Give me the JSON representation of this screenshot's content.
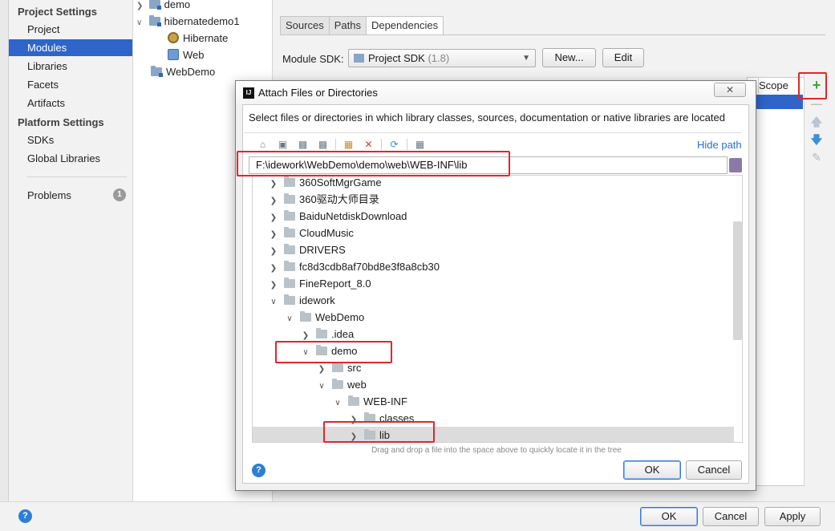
{
  "sidebar": {
    "project_settings_header": "Project Settings",
    "platform_settings_header": "Platform Settings",
    "items": [
      {
        "label": "Project"
      },
      {
        "label": "Modules"
      },
      {
        "label": "Libraries"
      },
      {
        "label": "Facets"
      },
      {
        "label": "Artifacts"
      },
      {
        "label": "SDKs"
      },
      {
        "label": "Global Libraries"
      },
      {
        "label": "Problems",
        "badge": "1"
      }
    ]
  },
  "module_tree": {
    "items": [
      {
        "label": "demo"
      },
      {
        "label": "hibernatedemo1"
      },
      {
        "label": "Hibernate"
      },
      {
        "label": "Web"
      },
      {
        "label": "WebDemo"
      }
    ]
  },
  "main": {
    "tabs": [
      "Sources",
      "Paths",
      "Dependencies"
    ],
    "sdk_label": "Module SDK:",
    "sdk_value": "Project SDK",
    "sdk_version": "(1.8)",
    "new_button": "New...",
    "edit_button": "Edit",
    "scope_header": "Scope"
  },
  "dialog": {
    "title": "Attach Files or Directories",
    "close_glyph": "✕",
    "description": "Select files or directories in which library classes, sources, documentation or native libraries are located",
    "hide_path": "Hide path",
    "path_value": "F:\\idework\\WebDemo\\demo\\web\\WEB-INF\\lib",
    "tree": [
      {
        "label": "360SoftMgrGame"
      },
      {
        "label": "360驱动大师目录"
      },
      {
        "label": "BaiduNetdiskDownload"
      },
      {
        "label": "CloudMusic"
      },
      {
        "label": "DRIVERS"
      },
      {
        "label": "fc8d3cdb8af70bd8e3f8a8cb30"
      },
      {
        "label": "FineReport_8.0"
      },
      {
        "label": "idework"
      },
      {
        "label": "WebDemo"
      },
      {
        "label": ".idea"
      },
      {
        "label": "demo"
      },
      {
        "label": "src"
      },
      {
        "label": "web"
      },
      {
        "label": "WEB-INF"
      },
      {
        "label": "classes"
      },
      {
        "label": "lib"
      }
    ],
    "drag_hint": "Drag and drop a file into the space above to quickly locate it in the tree",
    "ok_button": "OK",
    "cancel_button": "Cancel"
  },
  "footer": {
    "ok_button": "OK",
    "cancel_button": "Cancel",
    "apply_button": "Apply"
  },
  "colors": {
    "selection": "#2f65ca",
    "annotation_red": "#e0262c",
    "link_blue": "#2b6dd1",
    "add_green": "#3aa53a"
  }
}
